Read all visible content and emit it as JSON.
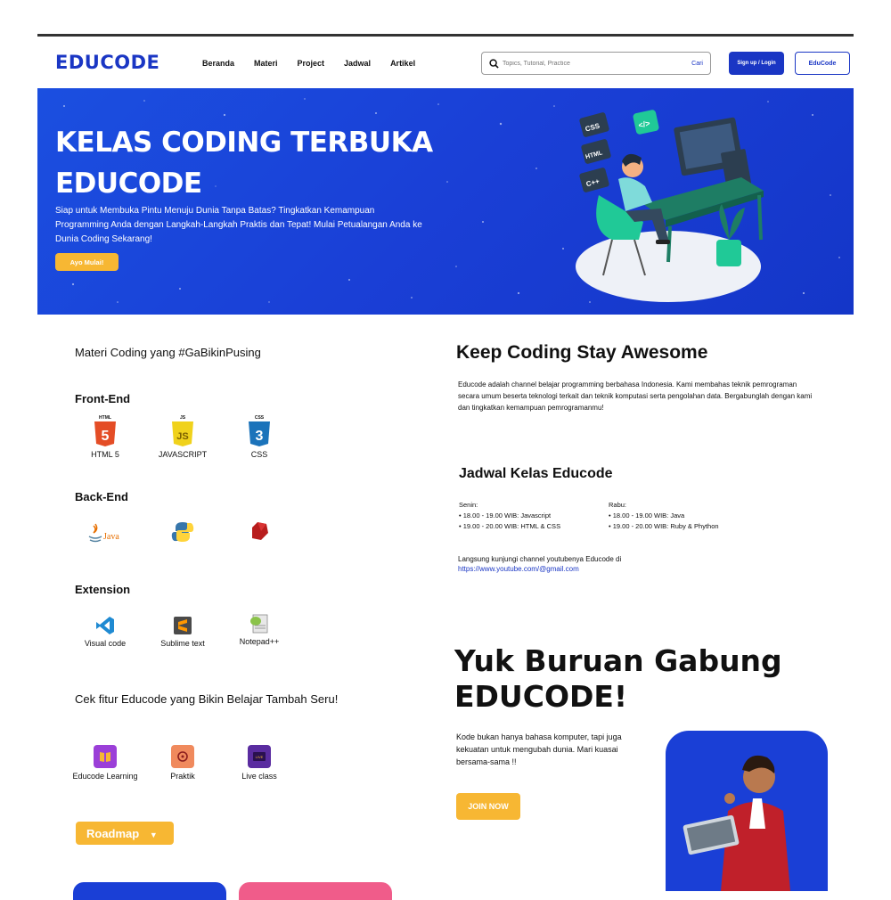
{
  "navbar": {
    "logo": "EDUCODE",
    "links": [
      "Beranda",
      "Materi",
      "Project",
      "Jadwal",
      "Artikel"
    ],
    "search_placeholder": "Topics, Tutorial, Practice",
    "search_button": "Cari",
    "login_button": "Sign up / Login",
    "educode_button": "EduCode"
  },
  "hero": {
    "title_line1": "KELAS CODING TERBUKA",
    "title_line2": "EDUCODE",
    "description": "Siap untuk Membuka Pintu Menuju Dunia Tanpa Batas? Tingkatkan Kemampuan Programming Anda dengan Langkah-Langkah Praktis dan Tepat! Mulai Petualangan Anda ke Dunia Coding Sekarang!",
    "cta": "Ayo Mulai!",
    "tags": [
      "CSS",
      "HTML",
      "C++"
    ]
  },
  "materi": {
    "heading": "Materi Coding yang #GaBikinPusing",
    "frontend_title": "Front-End",
    "frontend": [
      {
        "badge": "HTML",
        "glyph": "5",
        "label": "HTML 5",
        "color": "#e44d26"
      },
      {
        "badge": "JS",
        "glyph": "JS",
        "label": "JAVASCRIPT",
        "color": "#f0d21c"
      },
      {
        "badge": "CSS",
        "glyph": "3",
        "label": "CSS",
        "color": "#1b73ba"
      }
    ],
    "backend_title": "Back-End",
    "backend": [
      {
        "name": "java-icon",
        "text": "Java"
      },
      {
        "name": "python-icon"
      },
      {
        "name": "ruby-icon"
      }
    ],
    "extension_title": "Extension",
    "extensions": [
      {
        "label": "Visual code"
      },
      {
        "label": "Sublime text"
      },
      {
        "label": "Notepad++"
      }
    ]
  },
  "fitur": {
    "heading": "Cek fitur Educode yang Bikin Belajar Tambah Seru!",
    "items": [
      {
        "label": "Educode Learning",
        "color": "#9b3fd8"
      },
      {
        "label": "Praktik",
        "color": "#f08a5d"
      },
      {
        "label": "Live class",
        "color": "#5a2ca0"
      }
    ],
    "roadmap": "Roadmap"
  },
  "about": {
    "heading": "Keep Coding Stay Awesome",
    "text": "Educode adalah channel belajar programming berbahasa Indonesia. Kami membahas teknik pemrograman secara umum beserta teknologi terkait dan teknik komputasi serta pengolahan data. Bergabunglah dengan kami dan tingkatkan kemampuan pemrogramanmu!"
  },
  "jadwal": {
    "heading": "Jadwal Kelas  Educode",
    "senin_title": "Senin:",
    "senin": [
      "18.00 - 19.00 WIB: Javascript",
      "19.00 - 20.00 WIB: HTML & CSS"
    ],
    "rabu_title": "Rabu:",
    "rabu": [
      "18.00 - 19.00 WIB: Java",
      "19.00 - 20.00 WIB: Ruby & Phython"
    ],
    "youtube_text": "Langsung kunjungi channel youtubenya Educode di",
    "youtube_link": "https://www.youtube.com/@gmail.com"
  },
  "gabung": {
    "line1": "Yuk Buruan Gabung",
    "line2": "EDUCODE!",
    "text": "Kode bukan hanya bahasa komputer, tapi juga kekuatan untuk mengubah dunia. Mari kuasai bersama-sama !!",
    "button": "JOIN NOW"
  },
  "colors": {
    "primary": "#1a36c4",
    "accent": "#f7b733",
    "hero_bg": "#1b4fe0"
  }
}
